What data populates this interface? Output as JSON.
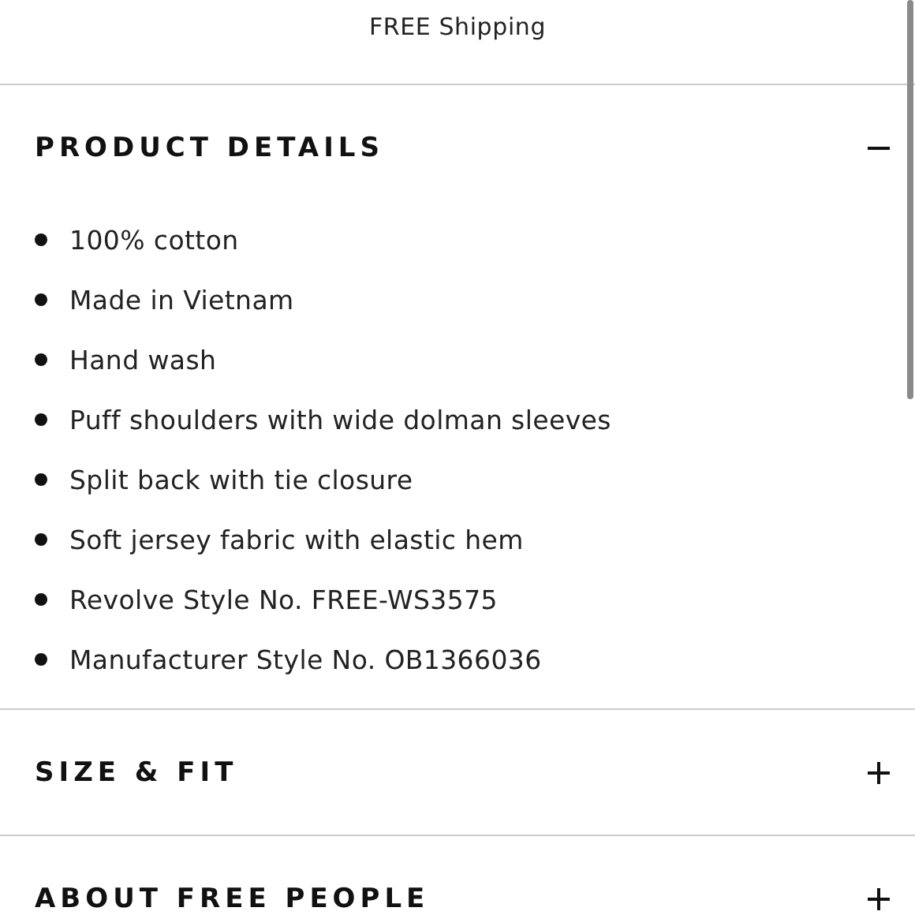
{
  "shipping": {
    "note": "FREE Shipping"
  },
  "sections": [
    {
      "title": "PRODUCT DETAILS",
      "expanded": true,
      "items": [
        "100% cotton",
        "Made in Vietnam",
        "Hand wash",
        "Puff shoulders with wide dolman sleeves",
        "Split back with tie closure",
        "Soft jersey fabric with elastic hem",
        "Revolve Style No. FREE-WS3575",
        "Manufacturer Style No. OB1366036"
      ]
    },
    {
      "title": "SIZE & FIT",
      "expanded": false
    },
    {
      "title": "ABOUT FREE PEOPLE",
      "expanded": false
    }
  ]
}
